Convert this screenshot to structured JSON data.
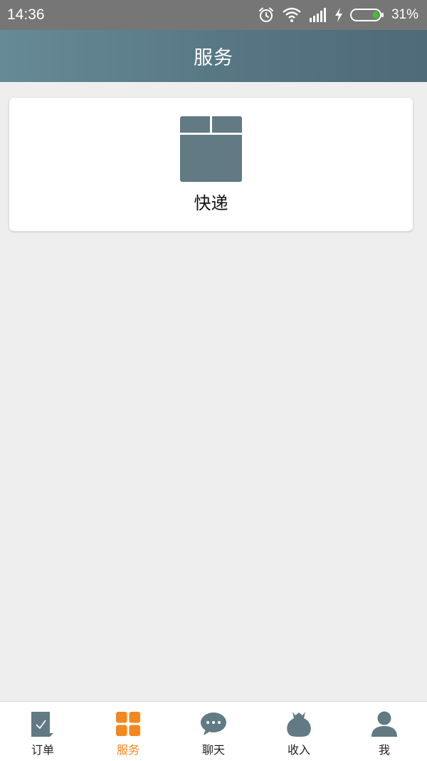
{
  "status_bar": {
    "time": "14:36",
    "battery_percent": "31%",
    "icons": [
      "alarm-icon",
      "wifi-icon",
      "signal-icon",
      "charging-icon",
      "battery-icon"
    ]
  },
  "header": {
    "title": "服务"
  },
  "services": [
    {
      "label": "快递",
      "icon": "parcel-box-icon"
    }
  ],
  "tabs": [
    {
      "label": "订单",
      "icon": "order-icon",
      "active": false
    },
    {
      "label": "服务",
      "icon": "services-grid-icon",
      "active": true
    },
    {
      "label": "聊天",
      "icon": "chat-icon",
      "active": false
    },
    {
      "label": "收入",
      "icon": "money-bag-icon",
      "active": false
    },
    {
      "label": "我",
      "icon": "person-icon",
      "active": false
    }
  ],
  "colors": {
    "header_start": "#668a96",
    "header_end": "#4f6a78",
    "icon_gray": "#617a84",
    "active_orange": "#f5871f",
    "battery_green": "#3ec32a",
    "background": "#eeeeee"
  }
}
